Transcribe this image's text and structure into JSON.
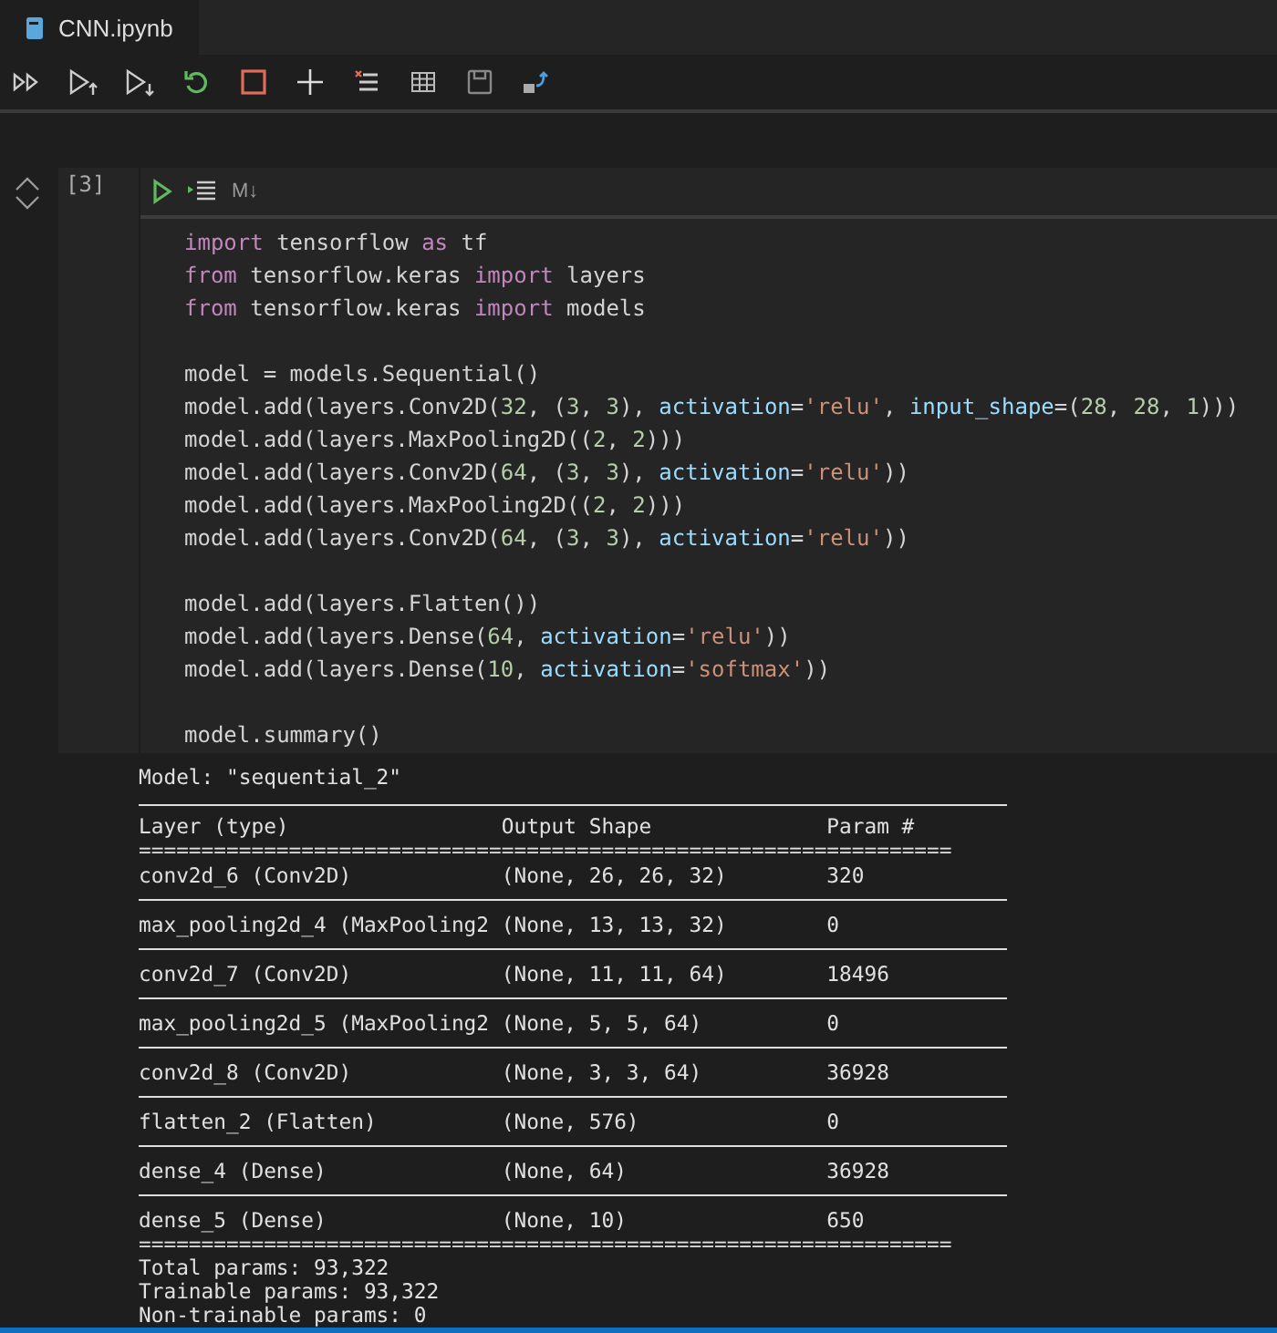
{
  "tab": {
    "title": "CNN.ipynb",
    "selected": true
  },
  "toolbar": [
    {
      "kind": "run-all"
    },
    {
      "kind": "run-above"
    },
    {
      "kind": "run-below"
    },
    {
      "kind": "restart"
    },
    {
      "kind": "interrupt"
    },
    {
      "kind": "add"
    },
    {
      "kind": "clear"
    },
    {
      "kind": "variables"
    },
    {
      "kind": "save"
    },
    {
      "kind": "export"
    }
  ],
  "cell": {
    "execution_count": "[3]",
    "cell_toolbar_label": "M↓",
    "code": [
      {
        "kind": "code",
        "tokens": [
          {
            "t": "import",
            "kind": "keyword"
          },
          {
            "t": " tensorflow ",
            "kind": "plain"
          },
          {
            "t": "as",
            "kind": "keyword"
          },
          {
            "t": " tf",
            "kind": "plain"
          }
        ]
      },
      {
        "kind": "code",
        "tokens": [
          {
            "t": "from",
            "kind": "keyword"
          },
          {
            "t": " tensorflow.keras ",
            "kind": "plain"
          },
          {
            "t": "import",
            "kind": "keyword"
          },
          {
            "t": " layers",
            "kind": "plain"
          }
        ]
      },
      {
        "kind": "code",
        "tokens": [
          {
            "t": "from",
            "kind": "keyword"
          },
          {
            "t": " tensorflow.keras ",
            "kind": "plain"
          },
          {
            "t": "import",
            "kind": "keyword"
          },
          {
            "t": " models",
            "kind": "plain"
          }
        ]
      },
      {
        "kind": "blank"
      },
      {
        "kind": "code",
        "tokens": [
          {
            "t": "model = models.Sequential()",
            "kind": "plain"
          }
        ]
      },
      {
        "kind": "code",
        "tokens": [
          {
            "t": "model.add(layers.Conv2D(",
            "kind": "plain"
          },
          {
            "t": "32",
            "kind": "number"
          },
          {
            "t": ", (",
            "kind": "plain"
          },
          {
            "t": "3",
            "kind": "number"
          },
          {
            "t": ", ",
            "kind": "plain"
          },
          {
            "t": "3",
            "kind": "number"
          },
          {
            "t": "), ",
            "kind": "plain"
          },
          {
            "t": "activation",
            "kind": "param"
          },
          {
            "t": "=",
            "kind": "plain"
          },
          {
            "t": "'relu'",
            "kind": "string"
          },
          {
            "t": ", ",
            "kind": "plain"
          },
          {
            "t": "input_shape",
            "kind": "param"
          },
          {
            "t": "=(",
            "kind": "plain"
          },
          {
            "t": "28",
            "kind": "number"
          },
          {
            "t": ", ",
            "kind": "plain"
          },
          {
            "t": "28",
            "kind": "number"
          },
          {
            "t": ", ",
            "kind": "plain"
          },
          {
            "t": "1",
            "kind": "number"
          },
          {
            "t": ")))",
            "kind": "plain"
          }
        ]
      },
      {
        "kind": "code",
        "tokens": [
          {
            "t": "model.add(layers.MaxPooling2D((",
            "kind": "plain"
          },
          {
            "t": "2",
            "kind": "number"
          },
          {
            "t": ", ",
            "kind": "plain"
          },
          {
            "t": "2",
            "kind": "number"
          },
          {
            "t": ")))",
            "kind": "plain"
          }
        ]
      },
      {
        "kind": "code",
        "tokens": [
          {
            "t": "model.add(layers.Conv2D(",
            "kind": "plain"
          },
          {
            "t": "64",
            "kind": "number"
          },
          {
            "t": ", (",
            "kind": "plain"
          },
          {
            "t": "3",
            "kind": "number"
          },
          {
            "t": ", ",
            "kind": "plain"
          },
          {
            "t": "3",
            "kind": "number"
          },
          {
            "t": "), ",
            "kind": "plain"
          },
          {
            "t": "activation",
            "kind": "param"
          },
          {
            "t": "=",
            "kind": "plain"
          },
          {
            "t": "'relu'",
            "kind": "string"
          },
          {
            "t": "))",
            "kind": "plain"
          }
        ]
      },
      {
        "kind": "code",
        "tokens": [
          {
            "t": "model.add(layers.MaxPooling2D((",
            "kind": "plain"
          },
          {
            "t": "2",
            "kind": "number"
          },
          {
            "t": ", ",
            "kind": "plain"
          },
          {
            "t": "2",
            "kind": "number"
          },
          {
            "t": ")))",
            "kind": "plain"
          }
        ]
      },
      {
        "kind": "code",
        "tokens": [
          {
            "t": "model.add(layers.Conv2D(",
            "kind": "plain"
          },
          {
            "t": "64",
            "kind": "number"
          },
          {
            "t": ", (",
            "kind": "plain"
          },
          {
            "t": "3",
            "kind": "number"
          },
          {
            "t": ", ",
            "kind": "plain"
          },
          {
            "t": "3",
            "kind": "number"
          },
          {
            "t": "), ",
            "kind": "plain"
          },
          {
            "t": "activation",
            "kind": "param"
          },
          {
            "t": "=",
            "kind": "plain"
          },
          {
            "t": "'relu'",
            "kind": "string"
          },
          {
            "t": "))",
            "kind": "plain"
          }
        ]
      },
      {
        "kind": "blank"
      },
      {
        "kind": "code",
        "tokens": [
          {
            "t": "model.add(layers.Flatten())",
            "kind": "plain"
          }
        ]
      },
      {
        "kind": "code",
        "tokens": [
          {
            "t": "model.add(layers.Dense(",
            "kind": "plain"
          },
          {
            "t": "64",
            "kind": "number"
          },
          {
            "t": ", ",
            "kind": "plain"
          },
          {
            "t": "activation",
            "kind": "param"
          },
          {
            "t": "=",
            "kind": "plain"
          },
          {
            "t": "'relu'",
            "kind": "string"
          },
          {
            "t": "))",
            "kind": "plain"
          }
        ]
      },
      {
        "kind": "code",
        "tokens": [
          {
            "t": "model.add(layers.Dense(",
            "kind": "plain"
          },
          {
            "t": "10",
            "kind": "number"
          },
          {
            "t": ", ",
            "kind": "plain"
          },
          {
            "t": "activation",
            "kind": "param"
          },
          {
            "t": "=",
            "kind": "plain"
          },
          {
            "t": "'softmax'",
            "kind": "string"
          },
          {
            "t": "))",
            "kind": "plain"
          }
        ]
      },
      {
        "kind": "blank"
      },
      {
        "kind": "code",
        "tokens": [
          {
            "t": "model.summary()",
            "kind": "plain"
          }
        ]
      }
    ]
  },
  "output": {
    "model_line": "Model: \"sequential_2\"",
    "columns": [
      "Layer (type)",
      "Output Shape",
      "Param #"
    ],
    "double_rule": "=================================================================",
    "rows": [
      {
        "layer": "conv2d_6 (Conv2D)",
        "shape": "(None, 26, 26, 32)",
        "params": "320"
      },
      {
        "layer": "max_pooling2d_4 (MaxPooling2",
        "shape": "(None, 13, 13, 32)",
        "params": "0"
      },
      {
        "layer": "conv2d_7 (Conv2D)",
        "shape": "(None, 11, 11, 64)",
        "params": "18496"
      },
      {
        "layer": "max_pooling2d_5 (MaxPooling2",
        "shape": "(None, 5, 5, 64)",
        "params": "0"
      },
      {
        "layer": "conv2d_8 (Conv2D)",
        "shape": "(None, 3, 3, 64)",
        "params": "36928"
      },
      {
        "layer": "flatten_2 (Flatten)",
        "shape": "(None, 576)",
        "params": "0"
      },
      {
        "layer": "dense_4 (Dense)",
        "shape": "(None, 64)",
        "params": "36928"
      },
      {
        "layer": "dense_5 (Dense)",
        "shape": "(None, 10)",
        "params": "650"
      }
    ],
    "double_rule_bottom": "=================================================================",
    "totals": [
      "Total params: 93,322",
      "Trainable params: 93,322",
      "Non-trainable params: 0"
    ]
  }
}
